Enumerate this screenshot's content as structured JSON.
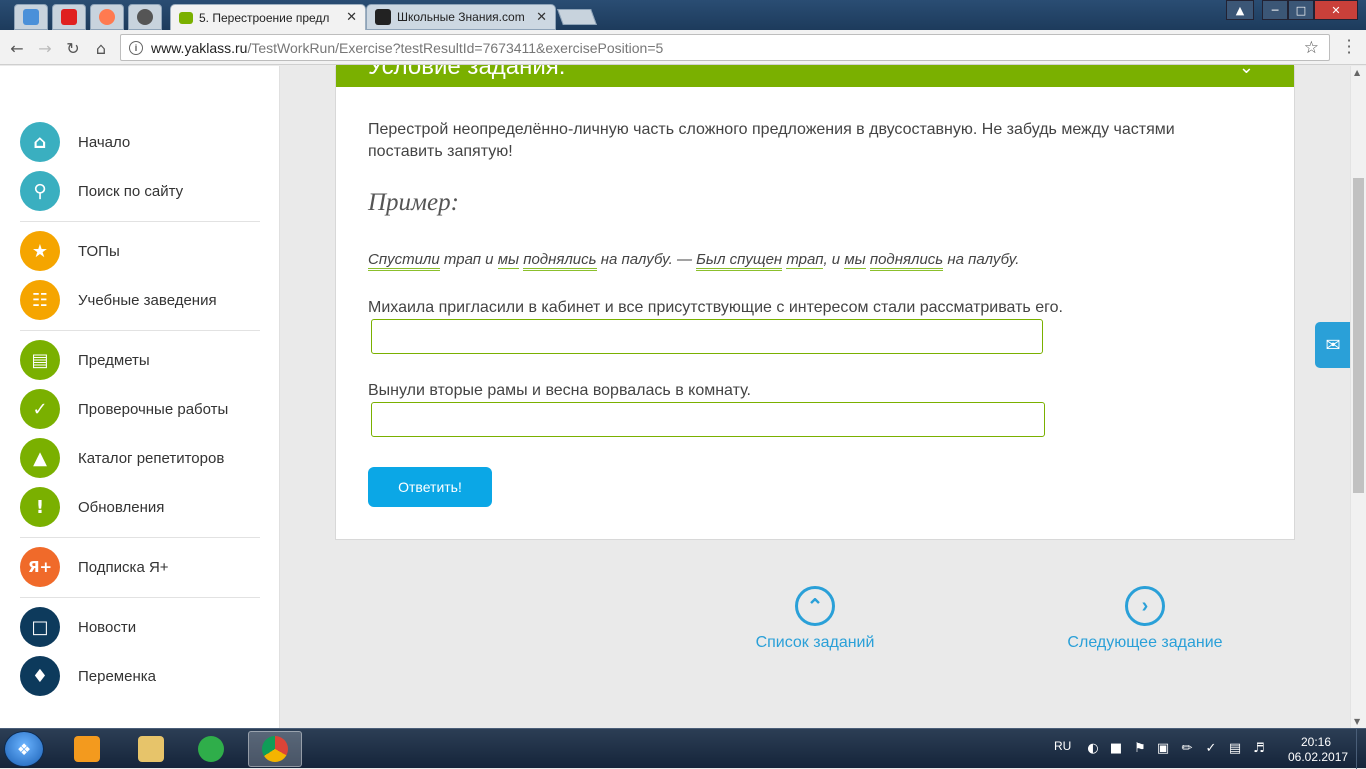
{
  "browser": {
    "tabs": [
      {
        "title": "5. Перестроение предл",
        "active": true
      },
      {
        "title": "Школьные Знания.com",
        "active": false
      }
    ],
    "pinned_tabs": [
      "chat-icon",
      "youtube-icon",
      "owl-icon",
      "shield-icon"
    ],
    "url_host": "www.yaklass.ru",
    "url_path": "/TestWorkRun/Exercise?testResultId=7673411&exercisePosition=5",
    "tab_close": "✕"
  },
  "sidebar": {
    "items": [
      {
        "label": "Начало",
        "icon": "home-icon",
        "color": "#3aafc0"
      },
      {
        "label": "Поиск по сайту",
        "icon": "search-icon",
        "color": "#3aafc0"
      },
      {
        "label": "ТОПы",
        "icon": "star-icon",
        "color": "#f5a500"
      },
      {
        "label": "Учебные заведения",
        "icon": "institution-icon",
        "color": "#f5a500"
      },
      {
        "label": "Предметы",
        "icon": "book-icon",
        "color": "#7ab000"
      },
      {
        "label": "Проверочные работы",
        "icon": "check-icon",
        "color": "#7ab000"
      },
      {
        "label": "Каталог репетиторов",
        "icon": "graduation-cap-icon",
        "color": "#7ab000"
      },
      {
        "label": "Обновления",
        "icon": "exclamation-icon",
        "color": "#7ab000"
      },
      {
        "label": "Подписка Я+",
        "icon": "ya-plus-icon",
        "color": "#f06a2a"
      },
      {
        "label": "Новости",
        "icon": "chat-bubble-icon",
        "color": "#0d3a5c"
      },
      {
        "label": "Переменка",
        "icon": "bell-icon",
        "color": "#0d3a5c"
      }
    ]
  },
  "card": {
    "header_title": "Условие задания:",
    "task_text": "Перестрой неопределённо-личную часть сложного предложения в двусоставную. Не забудь между частями поставить запятую!",
    "example_heading": "Пример:",
    "example": {
      "w1": "Спустили",
      "w2": " трап и ",
      "w3": "мы",
      "w4": " ",
      "w5": "поднялись",
      "w6": " на палубу. — ",
      "w7": "Был спущен",
      "w8": " ",
      "w9": "трап",
      "w10": ", и ",
      "w11": "мы",
      "w12": " ",
      "w13": "поднялись",
      "w14": " на палубу."
    },
    "questions": [
      {
        "text": "Михаила пригласили в кабинет и все присутствующие с интересом стали рассматривать его.",
        "value": ""
      },
      {
        "text": "Вынули вторые рамы и весна ворвалась в комнату.",
        "value": ""
      }
    ],
    "submit_label": "Ответить!"
  },
  "nav": {
    "list_label": "Список заданий",
    "next_label": "Следующее задание"
  },
  "taskbar": {
    "lang": "RU",
    "time": "20:16",
    "date": "06.02.2017"
  }
}
